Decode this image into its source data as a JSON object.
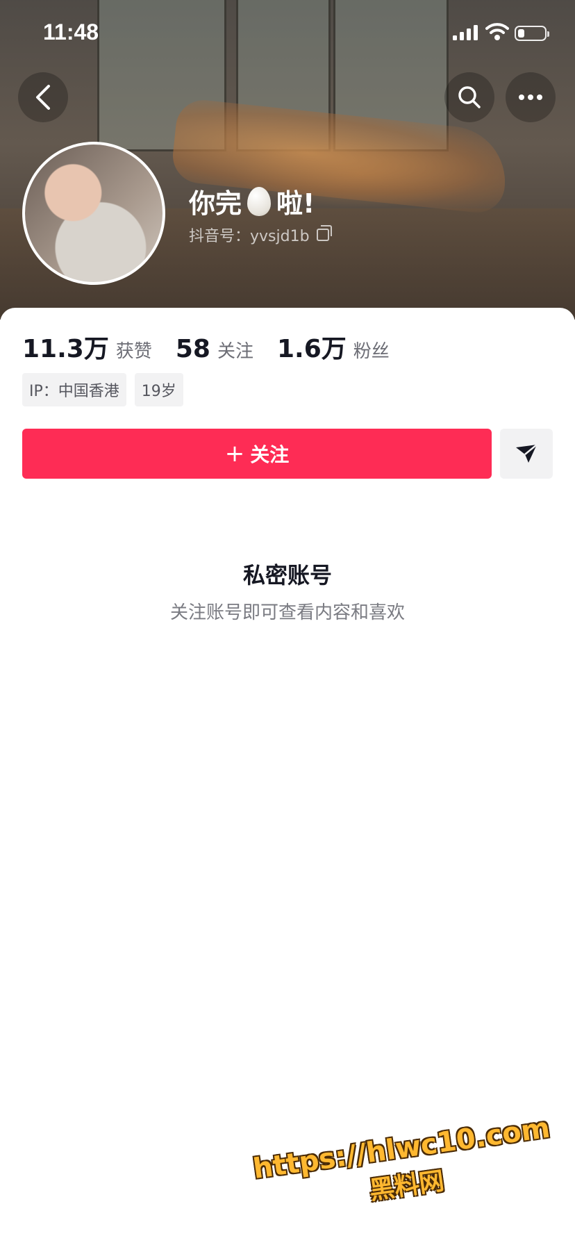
{
  "status_bar": {
    "time": "11:48",
    "battery_percent": 25
  },
  "header": {
    "nickname_prefix": "你完",
    "nickname_emoji": "egg",
    "nickname_suffix": "啦!",
    "douyin_id": "抖音号：yvsjd1b"
  },
  "stats": [
    {
      "value": "11.3万",
      "label": "获赞"
    },
    {
      "value": "58",
      "label": "关注"
    },
    {
      "value": "1.6万",
      "label": "粉丝"
    }
  ],
  "tags": [
    "IP：中国香港",
    "19岁"
  ],
  "follow_button": {
    "plus": "+",
    "label": "关注"
  },
  "private": {
    "title": "私密账号",
    "subtitle": "关注账号即可查看内容和喜欢"
  },
  "watermark": {
    "url": "https://hlwc10.com",
    "name": "黑料网"
  },
  "colors": {
    "accent": "#fe2c55",
    "text": "#161823",
    "muted": "#6c6d75"
  }
}
